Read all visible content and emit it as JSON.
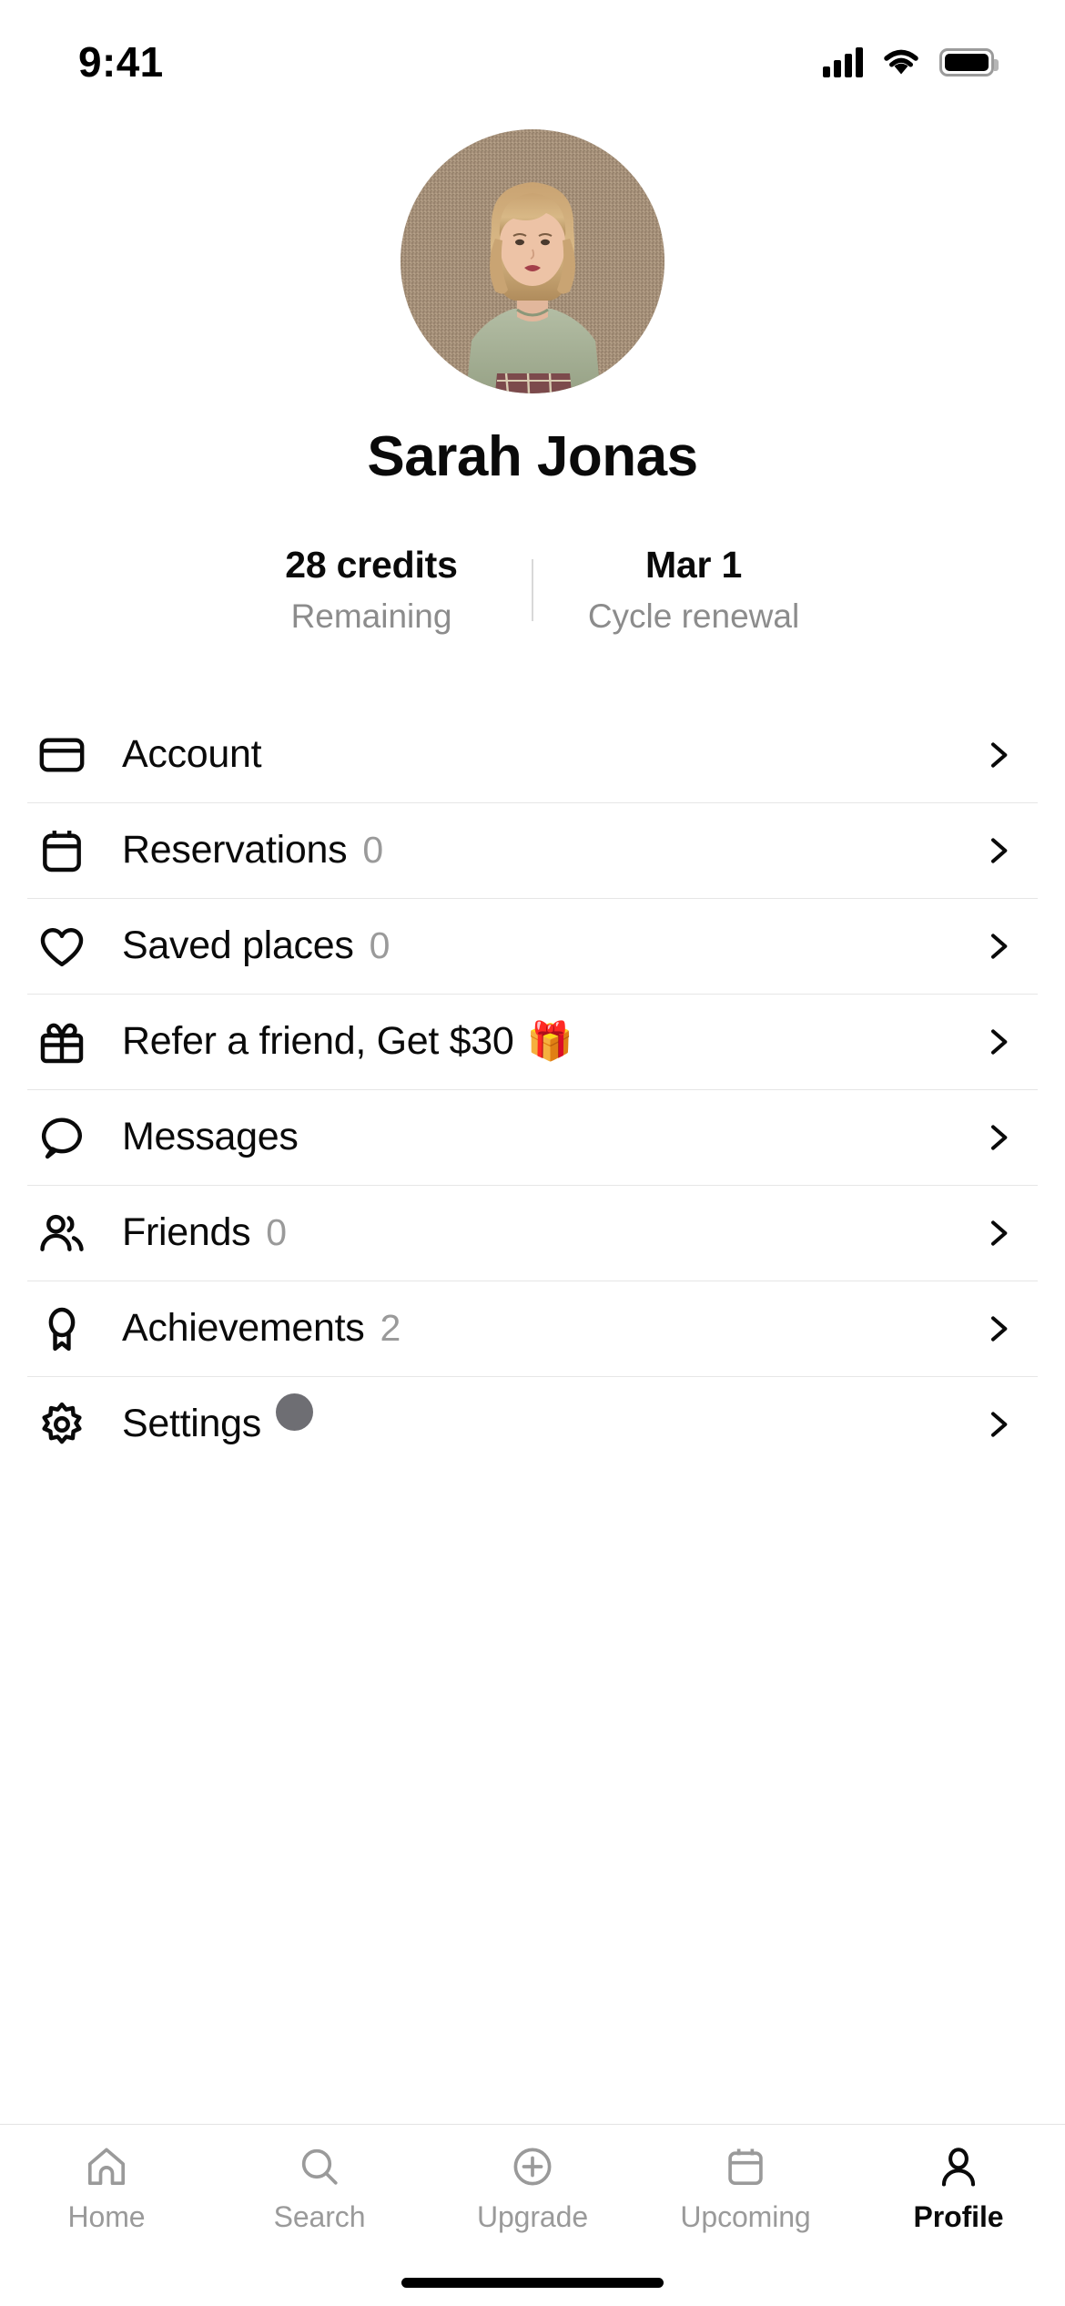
{
  "status_bar": {
    "time": "9:41",
    "signal_icon": "cellular-signal-icon",
    "wifi_icon": "wifi-icon",
    "battery_icon": "battery-full-icon"
  },
  "profile": {
    "avatar_alt": "user-avatar-photo",
    "name": "Sarah Jonas",
    "stats": [
      {
        "value": "28 credits",
        "label": "Remaining"
      },
      {
        "value": "Mar 1",
        "label": "Cycle renewal"
      }
    ]
  },
  "menu": {
    "items": [
      {
        "id": "account",
        "icon": "credit-card-icon",
        "label": "Account",
        "count": "",
        "emoji": "",
        "badge": false
      },
      {
        "id": "reservations",
        "icon": "calendar-icon",
        "label": "Reservations",
        "count": "0",
        "emoji": "",
        "badge": false
      },
      {
        "id": "saved-places",
        "icon": "heart-icon",
        "label": "Saved places",
        "count": "0",
        "emoji": "",
        "badge": false
      },
      {
        "id": "refer",
        "icon": "gift-icon",
        "label": "Refer a friend, Get $30",
        "count": "",
        "emoji": "🎁",
        "badge": false
      },
      {
        "id": "messages",
        "icon": "chat-bubble-icon",
        "label": "Messages",
        "count": "",
        "emoji": "",
        "badge": false
      },
      {
        "id": "friends",
        "icon": "people-icon",
        "label": "Friends",
        "count": "0",
        "emoji": "",
        "badge": false
      },
      {
        "id": "achievements",
        "icon": "award-icon",
        "label": "Achievements",
        "count": "2",
        "emoji": "",
        "badge": false
      },
      {
        "id": "settings",
        "icon": "gear-icon",
        "label": "Settings",
        "count": "",
        "emoji": "",
        "badge": true
      }
    ],
    "chevron_icon": "chevron-right-icon"
  },
  "tabbar": {
    "tabs": [
      {
        "id": "home",
        "icon": "home-icon",
        "label": "Home",
        "active": false
      },
      {
        "id": "search",
        "icon": "search-icon",
        "label": "Search",
        "active": false
      },
      {
        "id": "upgrade",
        "icon": "plus-circle-icon",
        "label": "Upgrade",
        "active": false
      },
      {
        "id": "upcoming",
        "icon": "calendar-icon",
        "label": "Upcoming",
        "active": false
      },
      {
        "id": "profile",
        "icon": "person-icon",
        "label": "Profile",
        "active": true
      }
    ]
  },
  "colors": {
    "text_primary": "#0a0a0a",
    "text_muted": "#9a9a9a",
    "divider": "#e6e6e6",
    "badge": "#6e6e73",
    "background": "#ffffff"
  },
  "home_indicator": "home-indicator"
}
